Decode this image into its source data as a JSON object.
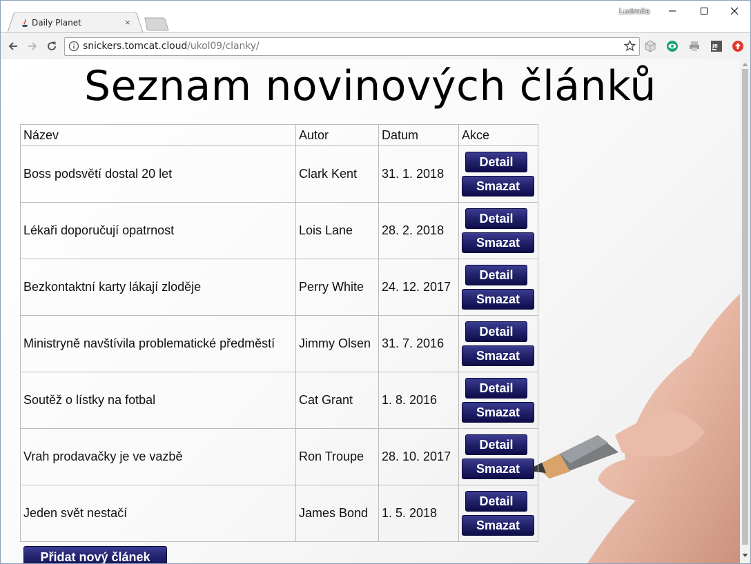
{
  "browser": {
    "tab_title": "Daily Planet",
    "tab_close": "×",
    "user_name": "Ludmila",
    "url_host": "snickers.tomcat.cloud",
    "url_path": "/ukol09/clanky/",
    "icons": [
      "back-icon",
      "forward-icon",
      "reload-icon",
      "info-icon",
      "star-icon",
      "extension-icons"
    ]
  },
  "page": {
    "title": "Seznam novinových článků",
    "columns": [
      "Název",
      "Autor",
      "Datum",
      "Akce"
    ],
    "detail_label": "Detail",
    "delete_label": "Smazat",
    "add_label": "Přidat nový článek",
    "articles": [
      {
        "title": "Boss podsvětí dostal 20 let",
        "author": "Clark Kent",
        "date": "31. 1. 2018"
      },
      {
        "title": "Lékaři doporučují opatrnost",
        "author": "Lois Lane",
        "date": "28. 2. 2018"
      },
      {
        "title": "Bezkontaktní karty lákají zloděje",
        "author": "Perry White",
        "date": "24. 12. 2017"
      },
      {
        "title": "Ministryně navštívila problematické předměstí",
        "author": "Jimmy Olsen",
        "date": "31. 7. 2016"
      },
      {
        "title": "Soutěž o lístky na fotbal",
        "author": "Cat Grant",
        "date": "1. 8. 2016"
      },
      {
        "title": "Vrah prodavačky je ve vazbě",
        "author": "Ron Troupe",
        "date": "28. 10. 2017"
      },
      {
        "title": "Jeden svět nestačí",
        "author": "James Bond",
        "date": "1. 5. 2018"
      }
    ]
  },
  "colors": {
    "button_top": "#3c3c92",
    "button_bottom": "#0d0d4a",
    "table_border": "#bcbcbc"
  }
}
